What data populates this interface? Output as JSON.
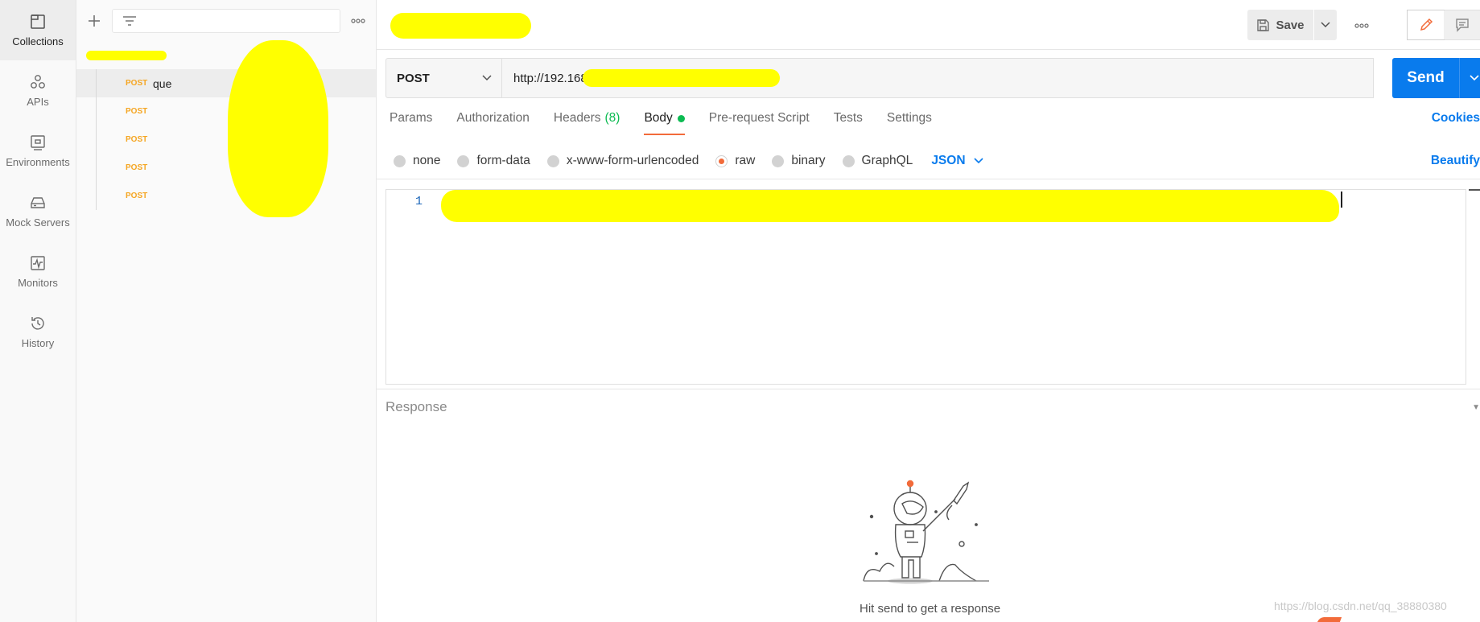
{
  "rail": {
    "items": [
      {
        "label": "Collections",
        "icon": "collections-icon"
      },
      {
        "label": "APIs",
        "icon": "apis-icon"
      },
      {
        "label": "Environments",
        "icon": "environments-icon"
      },
      {
        "label": "Mock Servers",
        "icon": "mock-servers-icon"
      },
      {
        "label": "Monitors",
        "icon": "monitors-icon"
      },
      {
        "label": "History",
        "icon": "history-icon"
      }
    ]
  },
  "sidebar": {
    "filter_placeholder": "",
    "requests": [
      {
        "method": "POST",
        "name": "que"
      },
      {
        "method": "POST",
        "name": ""
      },
      {
        "method": "POST",
        "name": ""
      },
      {
        "method": "POST",
        "name": ""
      },
      {
        "method": "POST",
        "name": ""
      }
    ]
  },
  "toolbar": {
    "save_label": "Save"
  },
  "request": {
    "method": "POST",
    "url": "http://192.168.",
    "send_label": "Send"
  },
  "tabs": {
    "params": "Params",
    "authorization": "Authorization",
    "headers": "Headers",
    "headers_count": "(8)",
    "body": "Body",
    "prerequest": "Pre-request Script",
    "tests": "Tests",
    "settings": "Settings",
    "cookies": "Cookies"
  },
  "body_options": {
    "none": "none",
    "form_data": "form-data",
    "urlencoded": "x-www-form-urlencoded",
    "raw": "raw",
    "binary": "binary",
    "graphql": "GraphQL",
    "lang": "JSON",
    "beautify": "Beautify"
  },
  "editor": {
    "line_number": "1"
  },
  "response": {
    "label": "Response",
    "empty_text": "Hit send to get a response"
  },
  "watermark": "https://blog.csdn.net/qq_38880380",
  "colors": {
    "accent": "#f26b3a",
    "primary": "#097bed",
    "success": "#0cbb52",
    "method_post": "#f5a623"
  }
}
